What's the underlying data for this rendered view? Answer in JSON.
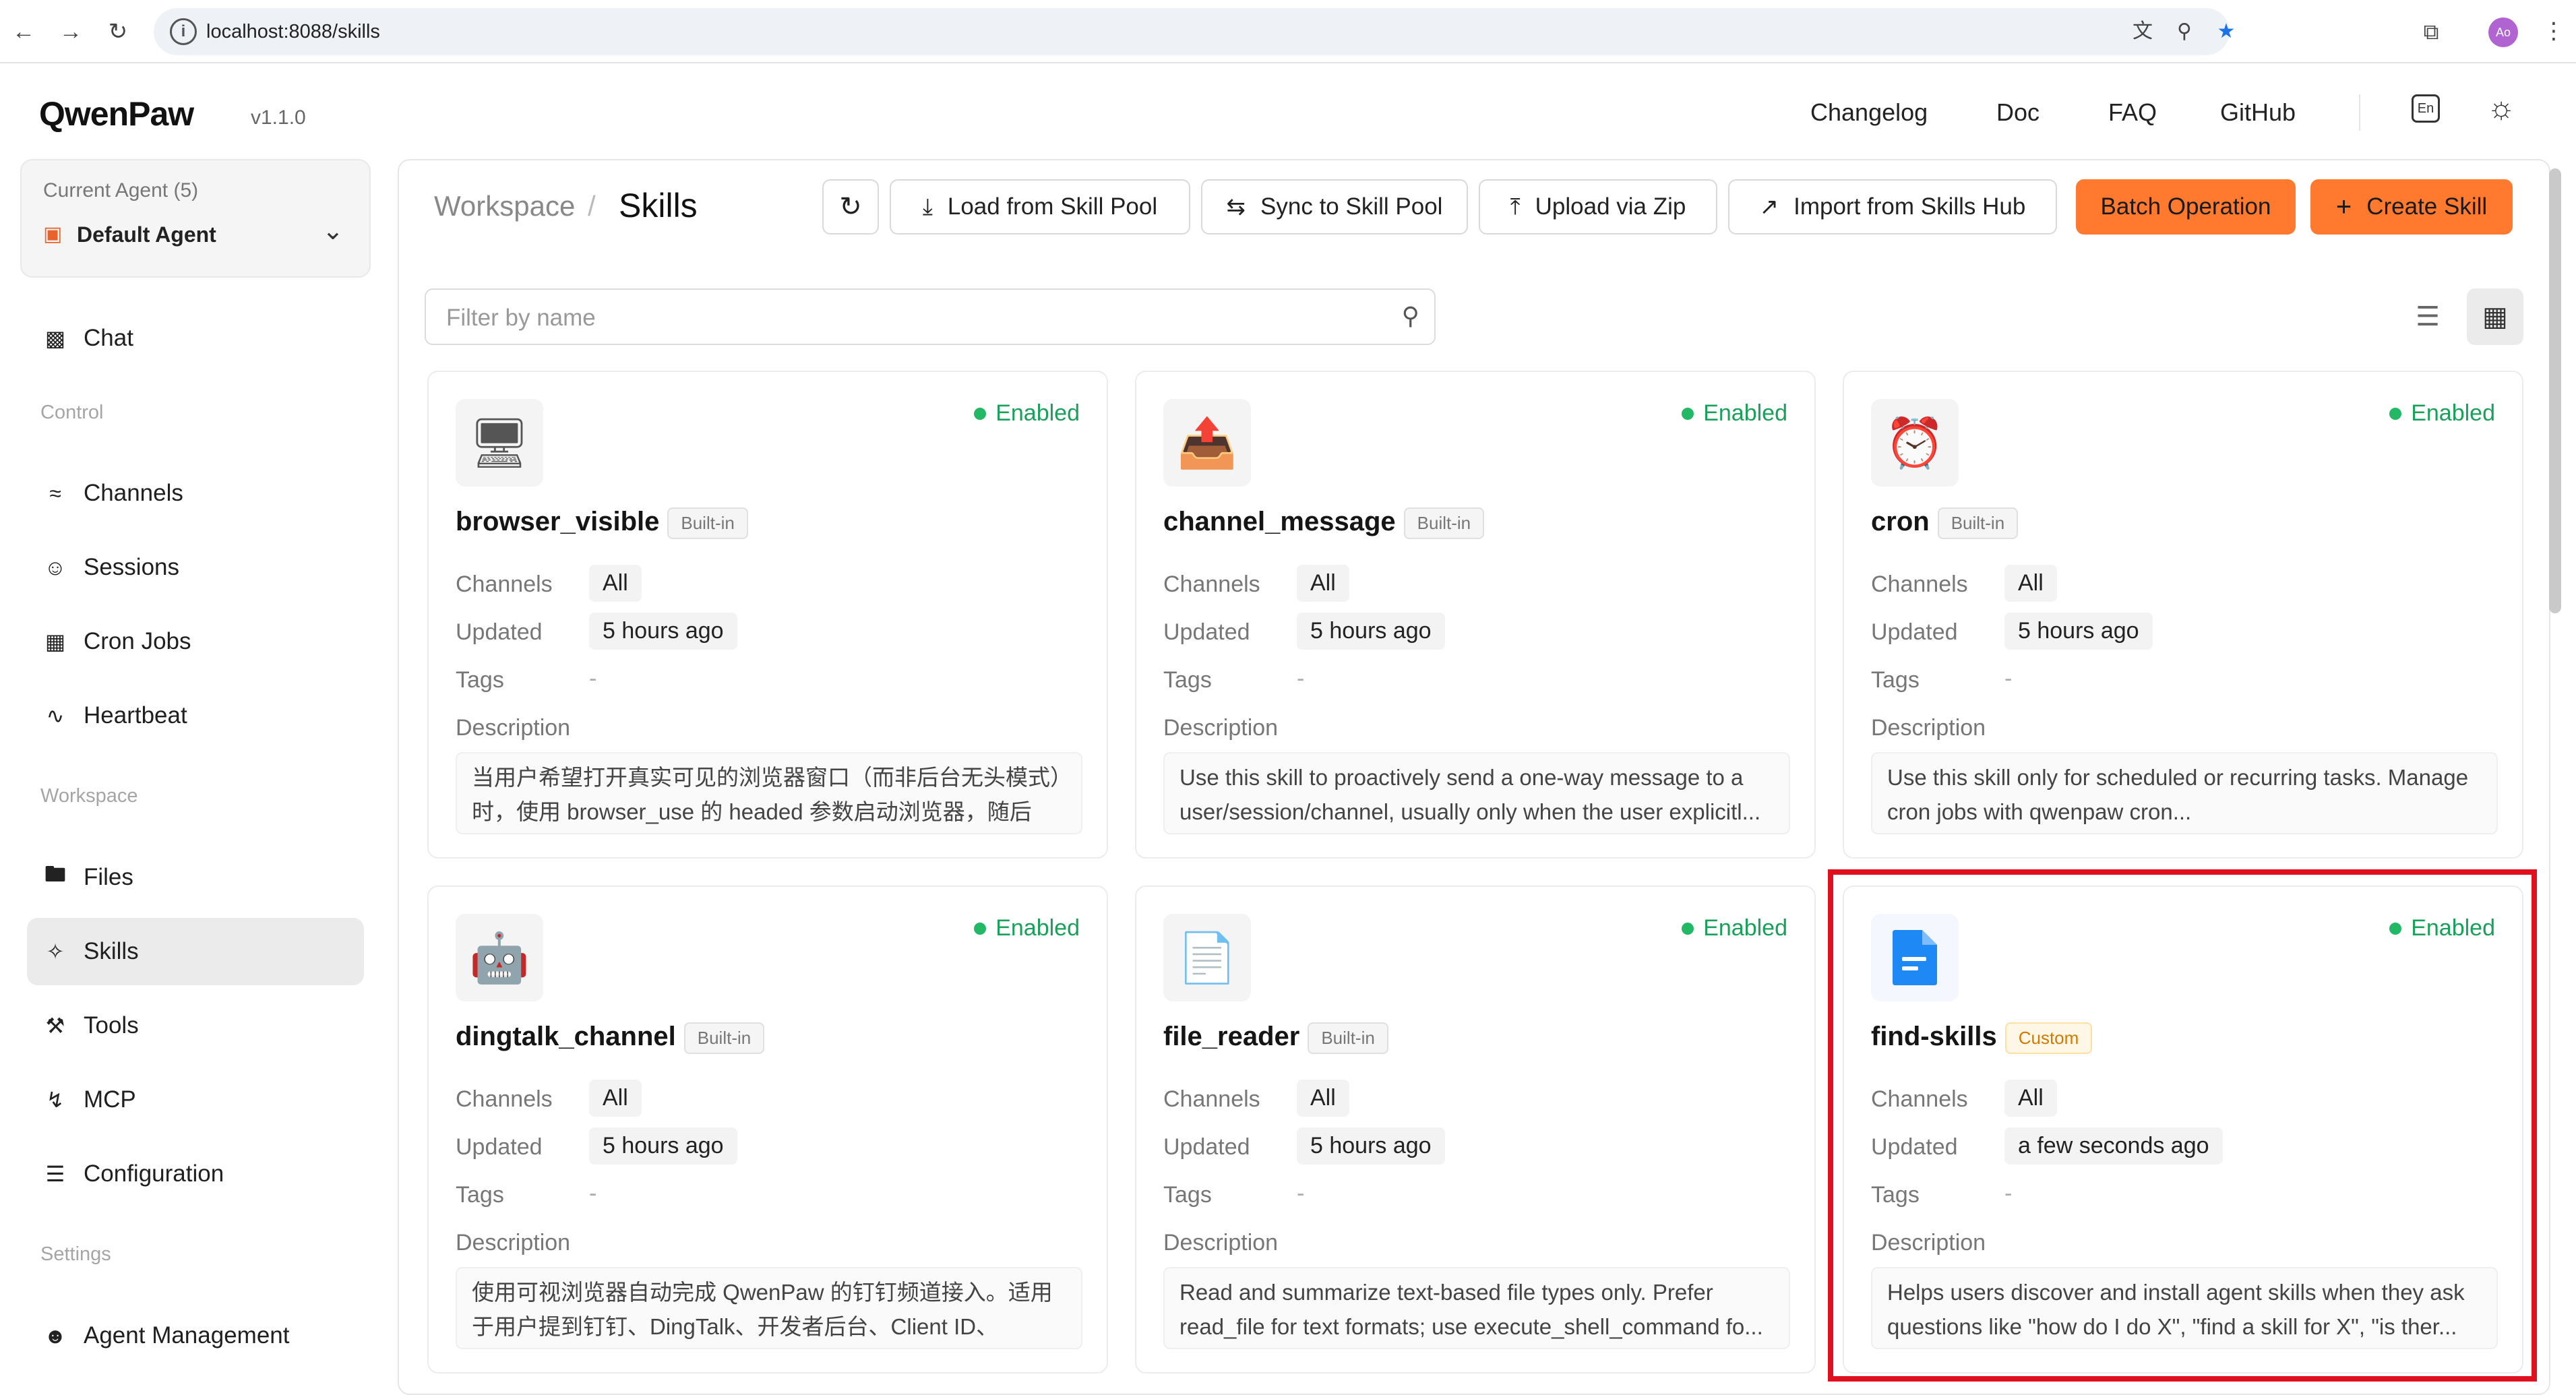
{
  "browser": {
    "url": "localhost:8088/skills",
    "profile_initials": "Ao"
  },
  "header": {
    "brand": "QwenPaw",
    "version": "v1.1.0",
    "nav": [
      "Changelog",
      "Doc",
      "FAQ",
      "GitHub"
    ],
    "lang_label": "En"
  },
  "sidebar": {
    "agent_label": "Current Agent (5)",
    "agent_name": "Default Agent",
    "chat": "Chat",
    "groups": {
      "control": "Control",
      "workspace": "Workspace",
      "settings": "Settings"
    },
    "control_items": [
      "Channels",
      "Sessions",
      "Cron Jobs",
      "Heartbeat"
    ],
    "workspace_items": [
      "Files",
      "Skills",
      "Tools",
      "MCP",
      "Configuration"
    ],
    "settings_items": [
      "Agent Management"
    ],
    "active": "Skills"
  },
  "breadcrumb": {
    "parent": "Workspace",
    "separator": "/",
    "current": "Skills"
  },
  "toolbar": {
    "load_pool": "Load from Skill Pool",
    "sync_pool": "Sync to Skill Pool",
    "upload_zip": "Upload via Zip",
    "import_hub": "Import from Skills Hub",
    "batch": "Batch Operation",
    "create": "Create Skill"
  },
  "filter": {
    "placeholder": "Filter by name"
  },
  "labels": {
    "channels": "Channels",
    "updated": "Updated",
    "tags": "Tags",
    "description": "Description",
    "enabled": "Enabled"
  },
  "skills": [
    {
      "name": "browser_visible",
      "badge": "Built-in",
      "icon": "desktop-computer-icon",
      "status": "Enabled",
      "channels": "All",
      "updated": "5 hours ago",
      "tags": "-",
      "description": "当用户希望打开真实可见的浏览器窗口（而非后台无头模式）时，使用 browser_use 的 headed 参数启动浏览器，随后可..."
    },
    {
      "name": "channel_message",
      "badge": "Built-in",
      "icon": "outbox-tray-icon",
      "status": "Enabled",
      "channels": "All",
      "updated": "5 hours ago",
      "tags": "-",
      "description": "Use this skill to proactively send a one-way message to a user/session/channel, usually only when the user explicitl..."
    },
    {
      "name": "cron",
      "badge": "Built-in",
      "icon": "alarm-clock-icon",
      "status": "Enabled",
      "channels": "All",
      "updated": "5 hours ago",
      "tags": "-",
      "description": "Use this skill only for scheduled or recurring tasks. Manage cron jobs with qwenpaw cron..."
    },
    {
      "name": "dingtalk_channel",
      "badge": "Built-in",
      "icon": "robot-icon",
      "status": "Enabled",
      "channels": "All",
      "updated": "5 hours ago",
      "tags": "-",
      "description": "使用可视浏览器自动完成 QwenPaw 的钉钉频道接入。适用于用户提到钉钉、DingTalk、开发者后台、Client ID、Client..."
    },
    {
      "name": "file_reader",
      "badge": "Built-in",
      "icon": "document-page-icon",
      "status": "Enabled",
      "channels": "All",
      "updated": "5 hours ago",
      "tags": "-",
      "description": "Read and summarize text-based file types only. Prefer read_file for text formats; use execute_shell_command fo..."
    },
    {
      "name": "find-skills",
      "badge": "Custom",
      "icon": "blue-document-icon",
      "status": "Enabled",
      "channels": "All",
      "updated": "a few seconds ago",
      "tags": "-",
      "description": "Helps users discover and install agent skills when they ask questions like \"how do I do X\", \"find a skill for X\", \"is ther..."
    }
  ],
  "colors": {
    "accent": "#ff7a2f",
    "enabled": "#22b865",
    "highlight": "#e0101e"
  }
}
